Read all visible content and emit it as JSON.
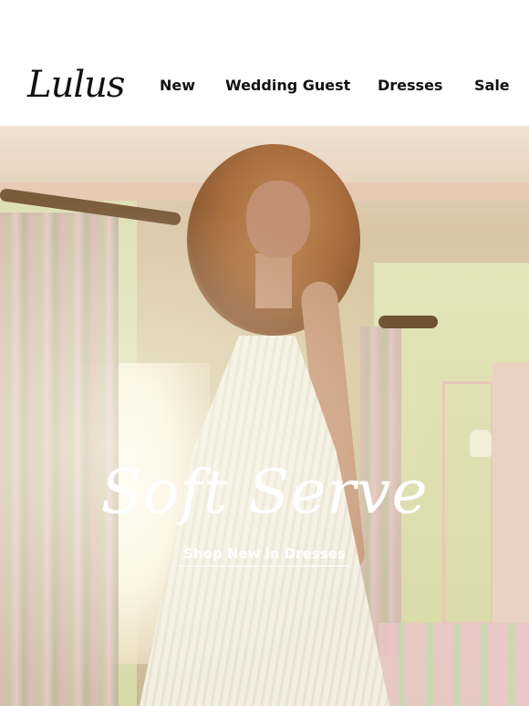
{
  "header": {
    "logo_text": "Lulus",
    "nav": [
      {
        "label": "New"
      },
      {
        "label": "Wedding Guest"
      },
      {
        "label": "Dresses"
      },
      {
        "label": "Sale"
      }
    ]
  },
  "hero": {
    "headline": "Soft Serve",
    "cta_label": "Shop New in Dresses",
    "image_description_icon": "model-in-white-pleated-dress-photo"
  }
}
